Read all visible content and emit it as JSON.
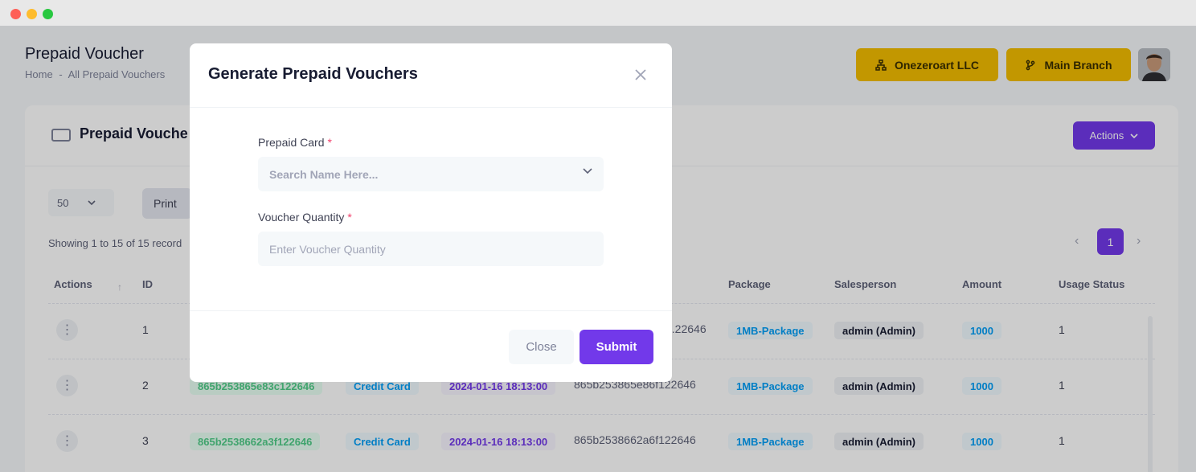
{
  "header": {
    "page_title": "Prepaid Voucher",
    "breadcrumb": [
      "Home",
      "-",
      "All Prepaid Vouchers"
    ],
    "company_button": "Onezeroart LLC",
    "branch_button": "Main Branch",
    "company_icon": "sitemap-icon",
    "branch_icon": "git-branch-icon"
  },
  "card": {
    "title": "Prepaid Vouche",
    "actions_label": "Actions",
    "page_size": "50",
    "print_label": "Print",
    "showing_text": "Showing 1 to 15 of 15 record",
    "current_page": "1"
  },
  "table": {
    "headers": {
      "actions": "Actions",
      "id": "ID",
      "package": "Package",
      "salesperson": "Salesperson",
      "amount": "Amount",
      "usage_status": "Usage Status"
    },
    "rows": [
      {
        "id": "1",
        "code": "",
        "type": "",
        "date": "",
        "serial": "...22646",
        "package": "1MB-Package",
        "salesperson": "admin (Admin)",
        "amount": "1000",
        "status": "1"
      },
      {
        "id": "2",
        "code": "865b253865e83c122646",
        "type": "Credit Card",
        "date": "2024-01-16 18:13:00",
        "serial": "865b253865e86f122646",
        "package": "1MB-Package",
        "salesperson": "admin (Admin)",
        "amount": "1000",
        "status": "1"
      },
      {
        "id": "3",
        "code": "865b2538662a3f122646",
        "type": "Credit Card",
        "date": "2024-01-16 18:13:00",
        "serial": "865b2538662a6f122646",
        "package": "1MB-Package",
        "salesperson": "admin (Admin)",
        "amount": "1000",
        "status": "1"
      }
    ]
  },
  "modal": {
    "title": "Generate Prepaid Vouchers",
    "prepaid_card_label": "Prepaid Card",
    "prepaid_card_placeholder": "Search Name Here...",
    "quantity_label": "Voucher Quantity",
    "quantity_placeholder": "Enter Voucher Quantity",
    "required_mark": "*",
    "close_label": "Close",
    "submit_label": "Submit"
  },
  "colors": {
    "primary": "#7239ea",
    "warning": "#f3bd00",
    "required": "#f1416c"
  }
}
